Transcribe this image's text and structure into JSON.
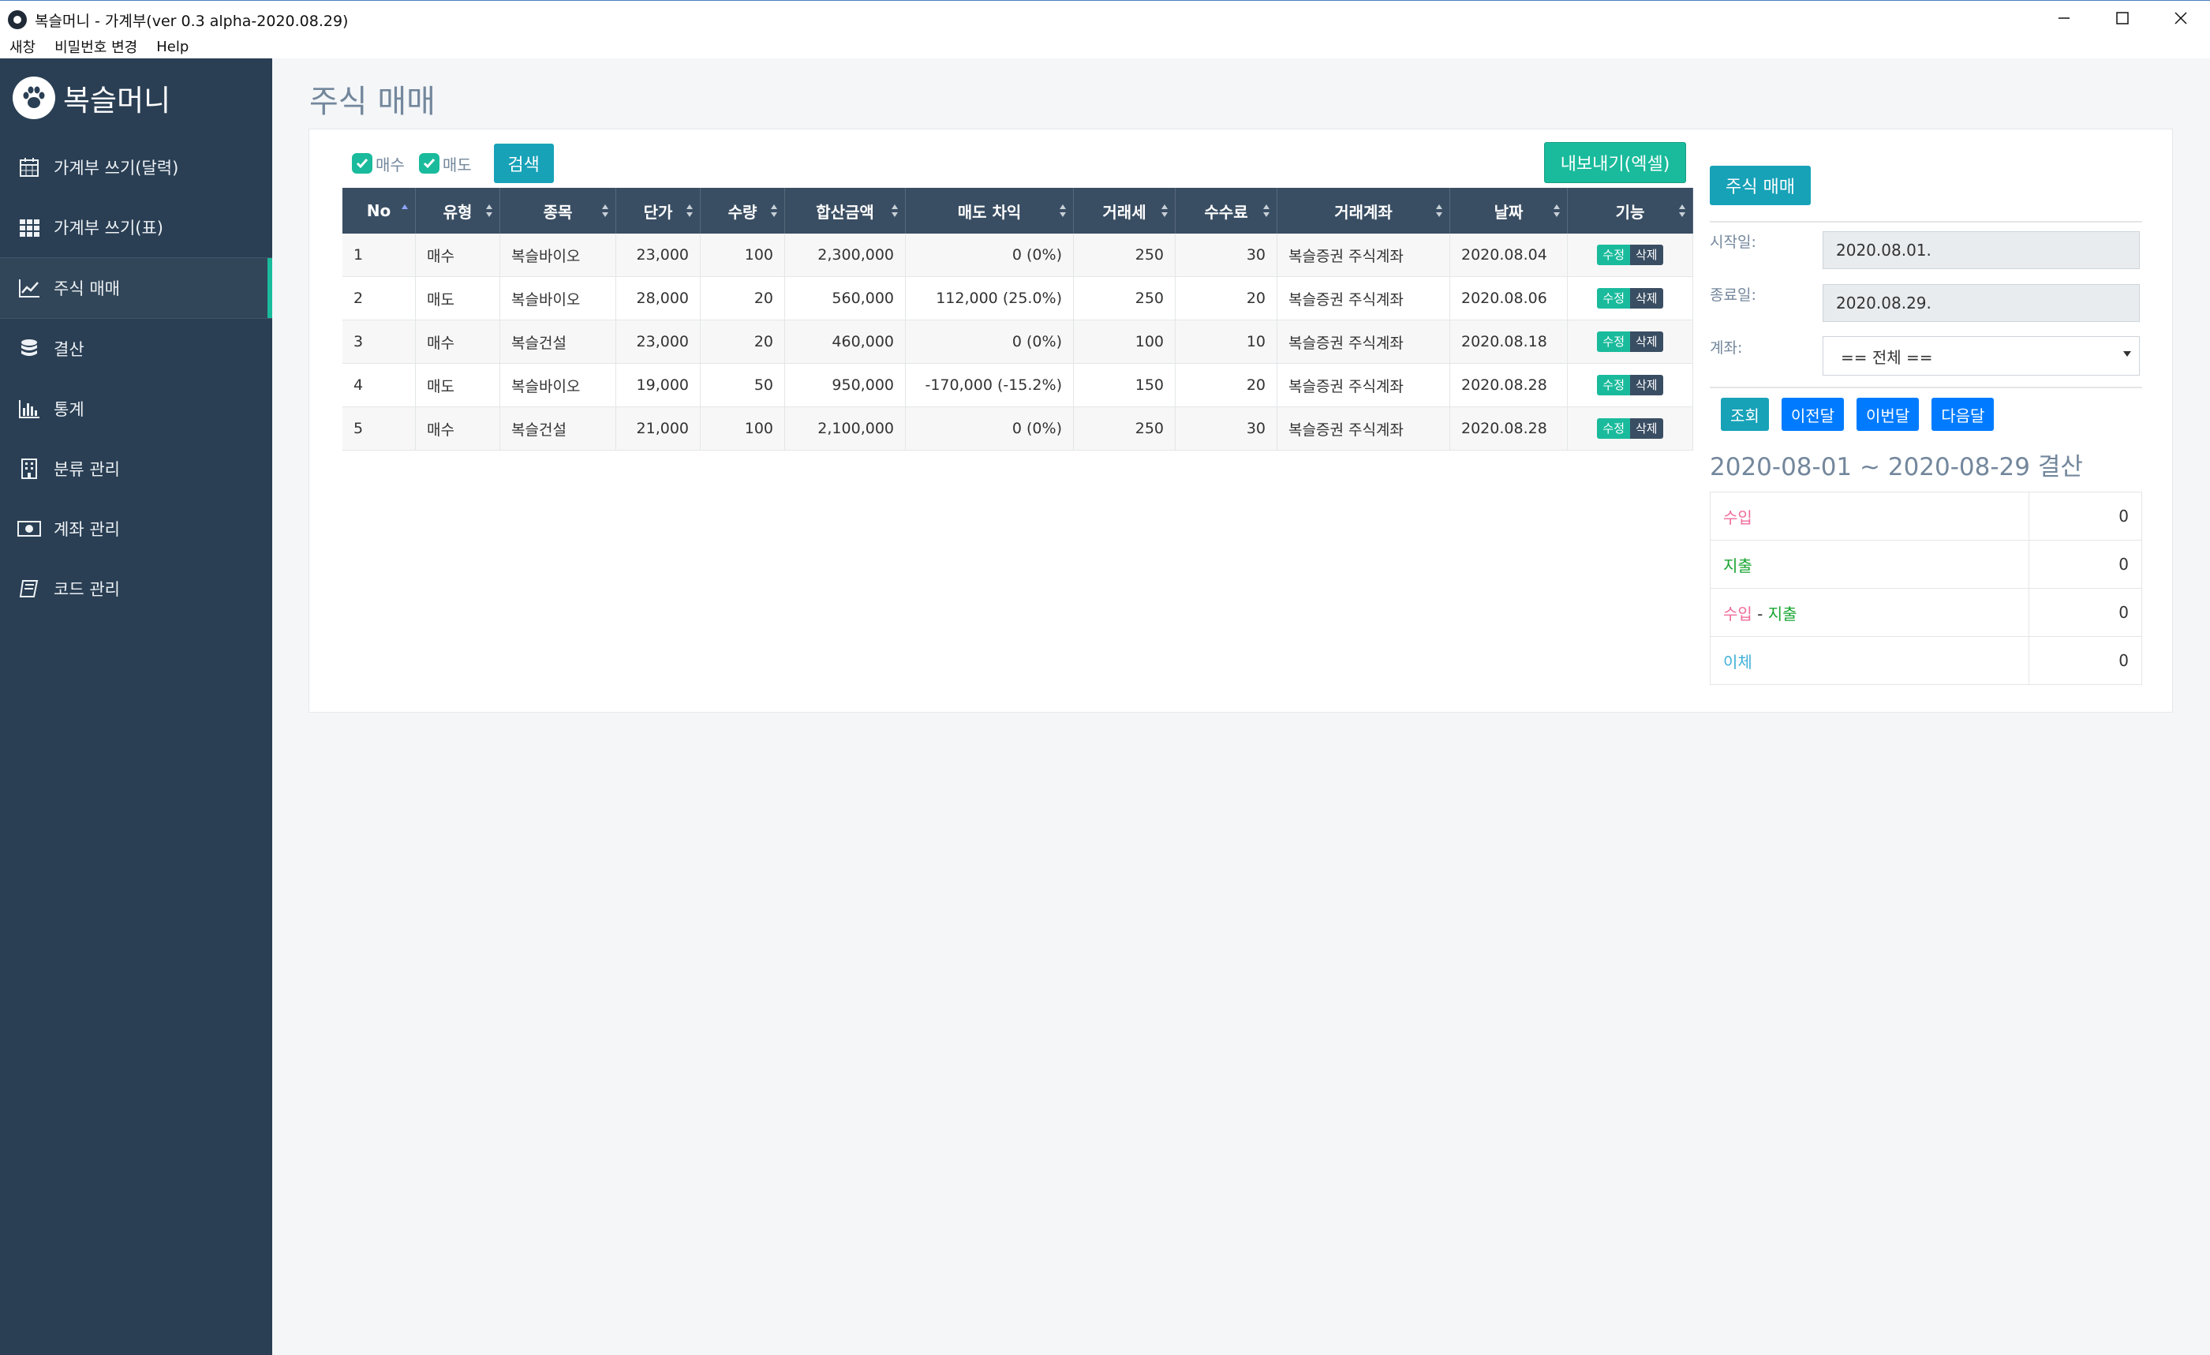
{
  "window": {
    "title": "복슬머니 - 가계부(ver 0.3 alpha-2020.08.29)"
  },
  "menu": [
    "새창",
    "비밀번호 변경",
    "Help"
  ],
  "sidebar": {
    "brand": "복슬머니",
    "items": [
      {
        "label": "가계부 쓰기(달력)",
        "icon": "calendar-icon"
      },
      {
        "label": "가계부 쓰기(표)",
        "icon": "grid-icon"
      },
      {
        "label": "주식 매매",
        "icon": "line-chart-icon",
        "active": true
      },
      {
        "label": "결산",
        "icon": "database-icon"
      },
      {
        "label": "통계",
        "icon": "bar-chart-icon"
      },
      {
        "label": "분류 관리",
        "icon": "building-icon"
      },
      {
        "label": "계좌 관리",
        "icon": "money-icon"
      },
      {
        "label": "코드 관리",
        "icon": "book-icon"
      }
    ]
  },
  "main": {
    "title": "주식 매매",
    "filters": {
      "buy": "매수",
      "sell": "매도",
      "search": "검색"
    },
    "export": "내보내기(엑셀)",
    "columns": [
      "No",
      "유형",
      "종목",
      "단가",
      "수량",
      "합산금액",
      "매도 차익",
      "거래세",
      "수수료",
      "거래계좌",
      "날짜",
      "기능"
    ],
    "rows": [
      {
        "no": "1",
        "type": "매수",
        "kind": "buy",
        "stock": "복슬바이오",
        "price": "23,000",
        "qty": "100",
        "total": "2,300,000",
        "profit": "0 (0%)",
        "pclass": "",
        "tax": "250",
        "fee": "30",
        "account": "복슬증권 주식계좌",
        "date": "2020.08.04"
      },
      {
        "no": "2",
        "type": "매도",
        "kind": "sell",
        "stock": "복슬바이오",
        "price": "28,000",
        "qty": "20",
        "total": "560,000",
        "profit": "112,000 (25.0%)",
        "pclass": "pos",
        "tax": "250",
        "fee": "20",
        "account": "복슬증권 주식계좌",
        "date": "2020.08.06"
      },
      {
        "no": "3",
        "type": "매수",
        "kind": "buy",
        "stock": "복슬건설",
        "price": "23,000",
        "qty": "20",
        "total": "460,000",
        "profit": "0 (0%)",
        "pclass": "",
        "tax": "100",
        "fee": "10",
        "account": "복슬증권 주식계좌",
        "date": "2020.08.18"
      },
      {
        "no": "4",
        "type": "매도",
        "kind": "sell",
        "stock": "복슬바이오",
        "price": "19,000",
        "qty": "50",
        "total": "950,000",
        "profit": "-170,000 (-15.2%)",
        "pclass": "neg",
        "tax": "150",
        "fee": "20",
        "account": "복슬증권 주식계좌",
        "date": "2020.08.28"
      },
      {
        "no": "5",
        "type": "매수",
        "kind": "buy",
        "stock": "복슬건설",
        "price": "21,000",
        "qty": "100",
        "total": "2,100,000",
        "profit": "0 (0%)",
        "pclass": "",
        "tax": "250",
        "fee": "30",
        "account": "복슬증권 주식계좌",
        "date": "2020.08.28"
      }
    ],
    "actions": {
      "edit": "수정",
      "delete": "삭제"
    }
  },
  "side": {
    "button": "주식 매매",
    "start_label": "시작일:",
    "start_value": "2020.08.01.",
    "end_label": "종료일:",
    "end_value": "2020.08.29.",
    "account_label": "계좌:",
    "account_value": "== 전체 ==",
    "nav": [
      "조회",
      "이전달",
      "이번달",
      "다음달"
    ],
    "summary_title": "2020-08-01 ~ 2020-08-29 결산",
    "summary": {
      "income_label": "수입",
      "income": "0",
      "expense_label": "지출",
      "expense": "0",
      "diff_left": "수입",
      "diff_sep": " - ",
      "diff_right": "지출",
      "diff": "0",
      "transfer_label": "이체",
      "transfer": "0"
    }
  },
  "colors": {
    "sidebar": "#2a3f54",
    "accent": "#1abb9c",
    "info": "#17a2b8",
    "primary": "#007bff",
    "buy": "#e0403f",
    "sell": "#2c6fb8"
  }
}
